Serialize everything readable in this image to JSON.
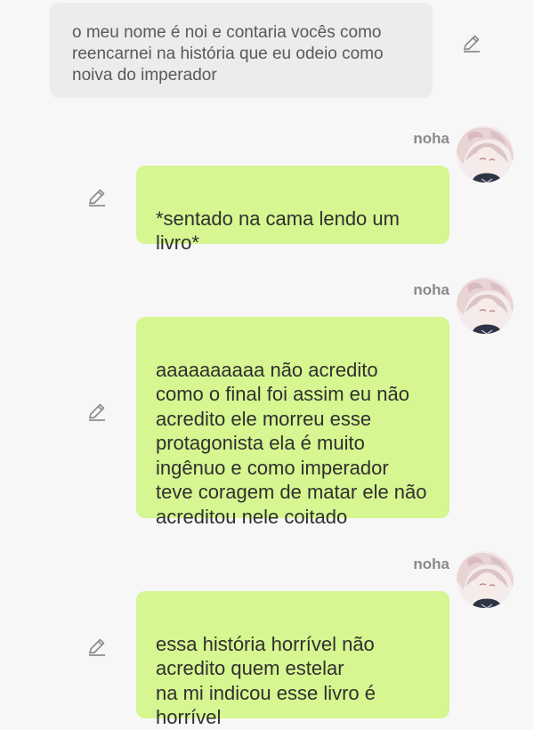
{
  "messages": [
    {
      "side": "left",
      "text": "o meu nome é noi e contaria vocês como reencarnei na história que eu odeio como noiva do imperador"
    },
    {
      "side": "right",
      "author": "noha",
      "text": "*sentado na cama lendo um livro*"
    },
    {
      "side": "right",
      "author": "noha",
      "text": "aaaaaaaaaa não acredito como o final foi assim eu não acredito ele morreu esse protagonista ela é muito ingênuo e como imperador teve coragem de matar ele não acreditou nele coitado"
    },
    {
      "side": "right",
      "author": "noha",
      "text": "essa história horrível não acredito quem estelar\n na mi indicou esse livro é horrível"
    }
  ],
  "icons": {
    "edit": "pencil-edit-icon",
    "avatar": "avatar-image"
  },
  "colors": {
    "background": "#f7f7f7",
    "left_bubble": "#ececec",
    "right_bubble": "#d5f690",
    "author": "#8a8a8a"
  }
}
